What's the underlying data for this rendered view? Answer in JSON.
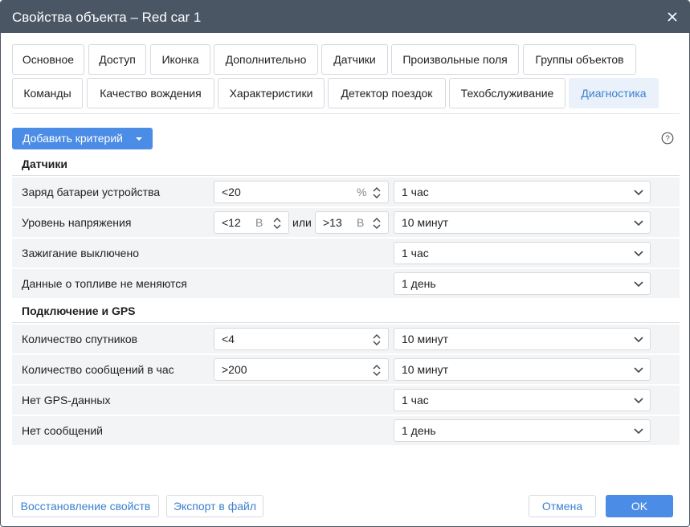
{
  "dialog": {
    "title": "Свойства объекта – Red car 1",
    "close_icon": "close-icon"
  },
  "tabs": [
    {
      "label": "Основное",
      "active": false
    },
    {
      "label": "Доступ",
      "active": false
    },
    {
      "label": "Иконка",
      "active": false
    },
    {
      "label": "Дополнительно",
      "active": false
    },
    {
      "label": "Датчики",
      "active": false
    },
    {
      "label": "Произвольные поля",
      "active": false
    },
    {
      "label": "Группы объектов",
      "active": false
    },
    {
      "label": "Команды",
      "active": false
    },
    {
      "label": "Качество вождения",
      "active": false
    },
    {
      "label": "Характеристики",
      "active": false
    },
    {
      "label": "Детектор поездок",
      "active": false
    },
    {
      "label": "Техобслуживание",
      "active": false
    },
    {
      "label": "Диагностика",
      "active": true
    }
  ],
  "toolbar": {
    "add_criteria_label": "Добавить критерий",
    "help_icon": "help-icon"
  },
  "sections": {
    "sensors": {
      "title": "Датчики",
      "rows": [
        {
          "label": "Заряд батареи устройства",
          "value": "<20",
          "unit": "%",
          "period": "1 час"
        },
        {
          "label": "Уровень напряжения",
          "value_from": "<12",
          "unit_from": "В",
          "or_label": "или",
          "value_to": ">13",
          "unit_to": "В",
          "period": "10 минут"
        },
        {
          "label": "Зажигание выключено",
          "period": "1 час"
        },
        {
          "label": "Данные о топливе не меняются",
          "period": "1 день"
        }
      ]
    },
    "connection": {
      "title": "Подключение и GPS",
      "rows": [
        {
          "label": "Количество спутников",
          "value": "<4",
          "period": "10 минут"
        },
        {
          "label": "Количество сообщений в час",
          "value": ">200",
          "period": "10 минут"
        },
        {
          "label": "Нет GPS-данных",
          "period": "1 час"
        },
        {
          "label": "Нет сообщений",
          "period": "1 день"
        }
      ]
    }
  },
  "footer": {
    "restore_label": "Восстановление свойств",
    "export_label": "Экспорт в файл",
    "cancel_label": "Отмена",
    "ok_label": "OK"
  },
  "colors": {
    "titlebar": "#4a5664",
    "accent": "#4b8de6",
    "link": "#3b80cf",
    "row_bg": "#f3f4f6"
  }
}
